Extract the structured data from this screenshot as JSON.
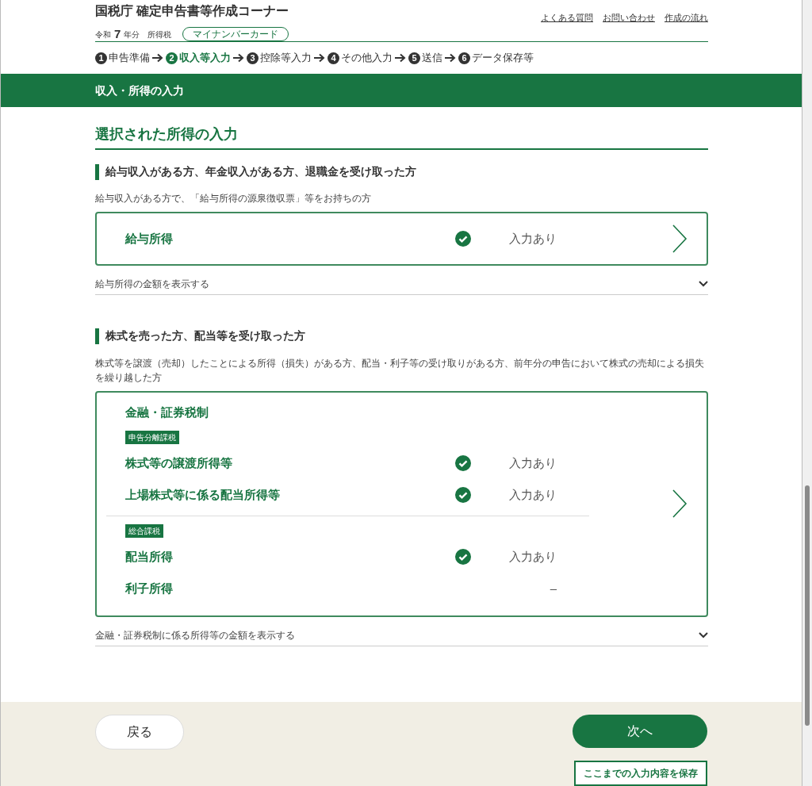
{
  "header": {
    "title": "国税庁 確定申告書等作成コーナー",
    "era": "令和",
    "year": "7",
    "year_suffix": "年分",
    "tax": "所得税",
    "badge": "マイナンバーカード",
    "links": [
      "よくある質問",
      "お問い合わせ",
      "作成の流れ"
    ]
  },
  "steps": [
    {
      "number": "1",
      "label": "申告準備",
      "selected": false
    },
    {
      "number": "2",
      "label": "収入等入力",
      "selected": true
    },
    {
      "number": "3",
      "label": "控除等入力",
      "selected": false
    },
    {
      "number": "4",
      "label": "その他入力",
      "selected": false
    },
    {
      "number": "5",
      "label": "送信",
      "selected": false
    },
    {
      "number": "6",
      "label": "データ保存等",
      "selected": false
    }
  ],
  "banner": "収入・所得の入力",
  "section_title": "選択された所得の入力",
  "groups": [
    {
      "heading": "給与収入がある方、年金収入がある方、退職金を受け取った方",
      "description": "給与収入がある方で、「給与所得の源泉徴収票」等をお持ちの方",
      "card": {
        "sections": [
          {
            "items": [
              {
                "name": "給与所得",
                "entered": true,
                "status": "入力あり"
              }
            ]
          }
        ]
      },
      "toggle": "給与所得の金額を表示する"
    },
    {
      "heading": "株式を売った方、配当等を受け取った方",
      "description": "株式等を譲渡（売却）したことによる所得（損失）がある方、配当・利子等の受け取りがある方、前年分の申告において株式の売却による損失を繰り越した方",
      "card": {
        "title": "金融・証券税制",
        "sections": [
          {
            "tag": "申告分離課税",
            "items": [
              {
                "name": "株式等の譲渡所得等",
                "entered": true,
                "status": "入力あり"
              },
              {
                "name": "上場株式等に係る配当所得等",
                "entered": true,
                "status": "入力あり"
              }
            ]
          },
          {
            "tag": "総合課税",
            "items": [
              {
                "name": "配当所得",
                "entered": true,
                "status": "入力あり"
              },
              {
                "name": "利子所得",
                "entered": false,
                "status": "–"
              }
            ]
          }
        ]
      },
      "toggle": "金融・証券税制に係る所得等の金額を表示する"
    }
  ],
  "footer": {
    "back": "戻る",
    "next": "次へ",
    "save": "ここまでの入力内容を保存"
  }
}
